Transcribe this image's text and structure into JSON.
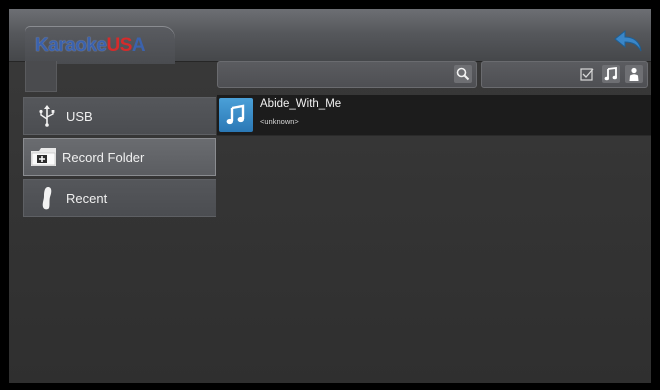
{
  "header": {
    "logo": {
      "part1": "Karaoke",
      "part2": "US",
      "part3": "A"
    },
    "back_icon": "back-arrow-icon",
    "accent": "#3a86c8"
  },
  "toolbar": {
    "search": {
      "value": "",
      "icon": "search-icon"
    },
    "filters": [
      {
        "name": "checkbox-filter",
        "icon": "checkbox-icon"
      },
      {
        "name": "music-filter",
        "icon": "music-note-icon"
      },
      {
        "name": "artist-filter",
        "icon": "person-icon"
      }
    ]
  },
  "sidebar": {
    "items": [
      {
        "label": "USB",
        "icon": "usb-icon",
        "selected": false
      },
      {
        "label": "Record Folder",
        "icon": "record-folder-icon",
        "selected": true
      },
      {
        "label": "Recent",
        "icon": "footprint-icon",
        "selected": false
      }
    ]
  },
  "files": [
    {
      "title": "Abide_With_Me",
      "artist": "<unknown>",
      "icon": "music-note-icon"
    }
  ],
  "colors": {
    "thumb": "#3a8ccb",
    "logo_blue": "#3b62ad",
    "logo_red": "#d62b2b"
  }
}
